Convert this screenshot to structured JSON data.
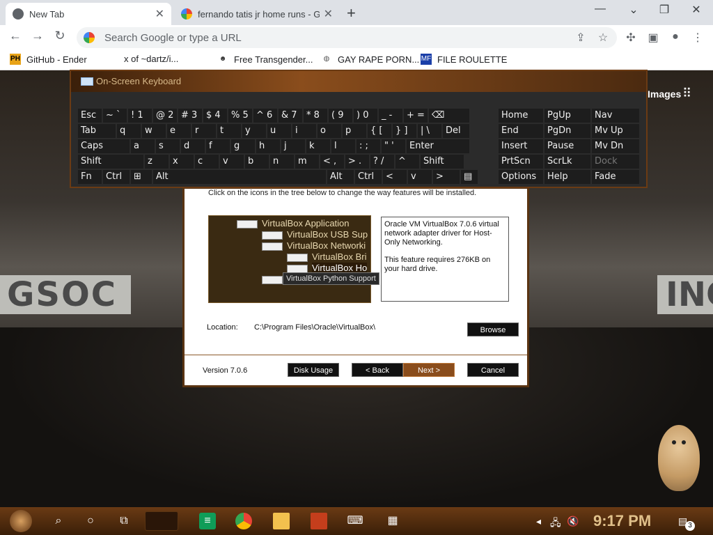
{
  "browser": {
    "tabs": [
      {
        "title": "New Tab",
        "active": true
      },
      {
        "title": "fernando tatis jr home runs - G",
        "active": false
      }
    ],
    "new_tab_label": "+",
    "omnibox_placeholder": "Search Google or type a URL",
    "bookmarks": [
      {
        "label": "GitHub - Ender",
        "icon": "ph-icon"
      },
      {
        "label": "x of ~dartz/i...",
        "icon": "folder-icon"
      },
      {
        "label": "Free Transgender...",
        "icon": "mask-icon"
      },
      {
        "label": "GAY RAPE PORN...",
        "icon": "globe-icon"
      },
      {
        "label": "FILE ROULETTE",
        "icon": "mf-icon"
      }
    ],
    "images_link": "Images",
    "window_controls": {
      "minimize": "—",
      "restore": "❐",
      "close": "✕"
    }
  },
  "osk": {
    "title": "On-Screen Keyboard",
    "rows": [
      [
        "Esc",
        "~ `",
        "! 1",
        "@ 2",
        "# 3",
        "$ 4",
        "% 5",
        "^ 6",
        "& 7",
        "* 8",
        "( 9",
        ") 0",
        "_ -",
        "+ =",
        "⌫"
      ],
      [
        "Tab",
        "q",
        "w",
        "e",
        "r",
        "t",
        "y",
        "u",
        "i",
        "o",
        "p",
        "{ [",
        "} ]",
        "| \\",
        "Del"
      ],
      [
        "Caps",
        "a",
        "s",
        "d",
        "f",
        "g",
        "h",
        "j",
        "k",
        "l",
        ": ;",
        "\" '",
        "Enter"
      ],
      [
        "Shift",
        "z",
        "x",
        "c",
        "v",
        "b",
        "n",
        "m",
        "< ,",
        "> .",
        "? /",
        "^",
        "Shift"
      ],
      [
        "Fn",
        "Ctrl",
        "⊞",
        "Alt",
        "Alt",
        "Ctrl",
        "<",
        "v",
        ">",
        "▤"
      ]
    ],
    "nav_keys": [
      [
        "Home",
        "PgUp",
        "Nav"
      ],
      [
        "End",
        "PgDn",
        "Mv Up"
      ],
      [
        "Insert",
        "Pause",
        "Mv Dn"
      ],
      [
        "PrtScn",
        "ScrLk",
        "Dock"
      ],
      [
        "Options",
        "Help",
        "Fade"
      ]
    ]
  },
  "installer": {
    "description": "Click on the icons in the tree below to change the way features will be installed.",
    "tree": [
      {
        "label": "VirtualBox Application",
        "level": 0
      },
      {
        "label": "VirtualBox USB Sup",
        "level": 1
      },
      {
        "label": "VirtualBox Networki",
        "level": 1
      },
      {
        "label": "VirtualBox Bri",
        "level": 2
      },
      {
        "label": "VirtualBox Ho",
        "level": 2,
        "selected": true
      },
      {
        "label": "VirtualBox Python Support",
        "level": 1
      }
    ],
    "tooltip": "VirtualBox Python Support",
    "info_text_1": "Oracle VM VirtualBox 7.0.6 virtual network adapter driver for Host-Only Networking.",
    "info_text_2": "This feature requires 276KB on your hard drive.",
    "location_label": "Location:",
    "location_value": "C:\\Program Files\\Oracle\\VirtualBox\\",
    "browse_label": "Browse",
    "version": "Version 7.0.6",
    "disk_usage_label": "Disk Usage",
    "back_label": "< Back",
    "next_label": "Next >",
    "cancel_label": "Cancel"
  },
  "taskbar": {
    "clock": "9:17 PM",
    "notification_count": "3",
    "apps": [
      "sheets-icon",
      "chrome-icon",
      "file-explorer-icon",
      "ppt-icon",
      "osk-icon",
      "installer-icon"
    ]
  },
  "background": {
    "left_sign": "GSOC",
    "right_sign": "INC"
  },
  "colors": {
    "accent": "#8a4d1c",
    "dialog_border": "#5a3412",
    "tree_bg": "#3a2a12",
    "clock": "#e0c08a"
  }
}
